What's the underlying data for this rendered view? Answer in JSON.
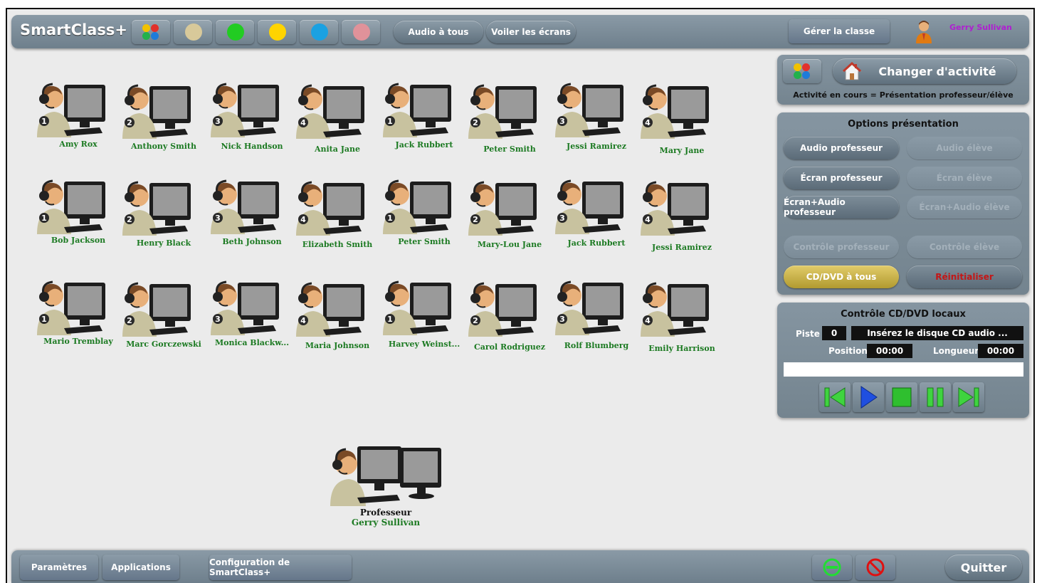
{
  "app": {
    "logo": "SmartClass+"
  },
  "topbar": {
    "color_buttons": [
      {
        "name": "multi-color-button",
        "colors": [
          "#f2c200",
          "#e2302b",
          "#22b14c",
          "#1e7bd9"
        ]
      },
      {
        "name": "beige-color-button",
        "color": "#d8c99a"
      },
      {
        "name": "green-color-button",
        "color": "#22cc22"
      },
      {
        "name": "yellow-color-button",
        "color": "#ffd400"
      },
      {
        "name": "blue-color-button",
        "color": "#1ba1e2"
      },
      {
        "name": "pink-color-button",
        "color": "#e0929a"
      }
    ],
    "audio_all": "Audio à tous",
    "veil_screens": "Voiler les écrans",
    "manage_class": "Gérer la classe",
    "user_name": "Gerry Sullivan"
  },
  "students": [
    {
      "name": "Amy Rox",
      "num": "1"
    },
    {
      "name": "Anthony Smith",
      "num": "2"
    },
    {
      "name": "Nick Handson",
      "num": "3"
    },
    {
      "name": "Anita Jane",
      "num": "4"
    },
    {
      "name": "Jack Rubbert",
      "num": "1"
    },
    {
      "name": "Peter Smith",
      "num": "2"
    },
    {
      "name": "Jessi Ramirez",
      "num": "3"
    },
    {
      "name": "Mary Jane",
      "num": "4"
    },
    {
      "name": "Bob Jackson",
      "num": "1"
    },
    {
      "name": "Henry Black",
      "num": "2"
    },
    {
      "name": "Beth Johnson",
      "num": "3"
    },
    {
      "name": "Elizabeth Smith",
      "num": "4"
    },
    {
      "name": "Peter Smith",
      "num": "1"
    },
    {
      "name": "Mary-Lou Jane",
      "num": "2"
    },
    {
      "name": "Jack Rubbert",
      "num": "3"
    },
    {
      "name": "Jessi Ramirez",
      "num": "4"
    },
    {
      "name": "Mario Tremblay",
      "num": "1"
    },
    {
      "name": "Marc Gorczewski",
      "num": "2"
    },
    {
      "name": "Monica Blackw...",
      "num": "3"
    },
    {
      "name": "Maria Johnson",
      "num": "4"
    },
    {
      "name": "Harvey Weinst...",
      "num": "1"
    },
    {
      "name": "Carol Rodriguez",
      "num": "2"
    },
    {
      "name": "Rolf Blumberg",
      "num": "3"
    },
    {
      "name": "Emily Harrison",
      "num": "4"
    }
  ],
  "teacher": {
    "role": "Professeur",
    "name": "Gerry Sullivan"
  },
  "activity_panel": {
    "change_activity": "Changer d'activité",
    "current": "Activité en cours = Présentation professeur/élève"
  },
  "options_panel": {
    "title": "Options présentation",
    "audio_teacher": "Audio professeur",
    "audio_student": "Audio élève",
    "screen_teacher": "Écran professeur",
    "screen_student": "Écran élève",
    "screen_audio_teacher": "Écran+Audio professeur",
    "screen_audio_student": "Écran+Audio élève",
    "control_teacher": "Contrôle professeur",
    "control_student": "Contrôle élève",
    "cd_dvd_all": "CD/DVD à tous",
    "reset": "Réinitialiser"
  },
  "cd_panel": {
    "title": "Contrôle CD/DVD locaux",
    "track_label": "Piste",
    "track_value": "0",
    "disc_message": "Insérez le disque CD audio ...",
    "position_label": "Position",
    "position_value": "00:00",
    "length_label": "Longueur",
    "length_value": "00:00",
    "progress": 0
  },
  "bottombar": {
    "settings": "Paramètres",
    "applications": "Applications",
    "configuration": "Configuration de SmartClass+",
    "quit": "Quitter"
  }
}
